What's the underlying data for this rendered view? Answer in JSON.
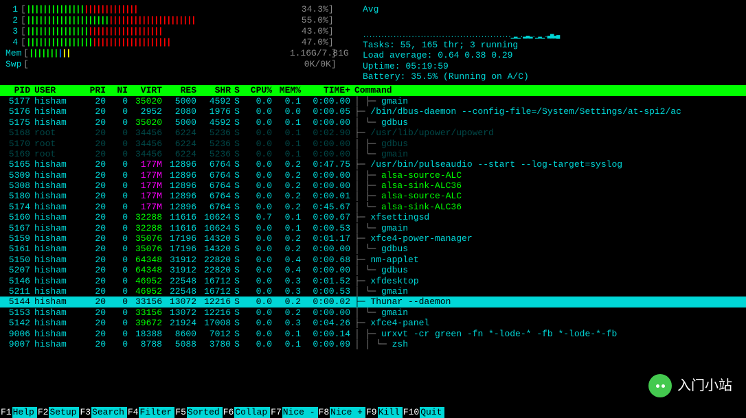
{
  "cpus": [
    {
      "n": "1",
      "bars": "ggggggggggggggrrrrrrrrrrrrr",
      "pct": "34.3%"
    },
    {
      "n": "2",
      "bars": "ggggggggggggggggggggrrrrrrrrrrrrrrrrrrrrr",
      "pct": "55.0%"
    },
    {
      "n": "3",
      "bars": "gggggggggggggggrrrrrrrrrrrrrrrrrr",
      "pct": "43.0%"
    },
    {
      "n": "4",
      "bars": "ggggggggggggggggrrrrrrrrrrrrrrrrrrr",
      "pct": "47.0%"
    }
  ],
  "mem": {
    "label": "Mem",
    "bars": "gggggggbyy",
    "val": "1.16G/7.81G"
  },
  "swp": {
    "label": "Swp",
    "val": "0K/0K"
  },
  "avg_label": "Avg",
  "tasks": "Tasks: 55, 165 thr; 3 running",
  "load": "Load average: 0.64 0.38 0.29",
  "uptime": "Uptime: 05:19:59",
  "battery": "Battery: 35.5% (Running on A/C)",
  "columns": {
    "pid": "PID",
    "user": "USER",
    "pri": "PRI",
    "ni": "NI",
    "virt": "VIRT",
    "res": "RES",
    "shr": "SHR",
    "s": "S",
    "cpu": "CPU%",
    "mem": "MEM%",
    "time": "TIME+",
    "cmd": "Command"
  },
  "rows": [
    {
      "pid": "5177",
      "user": "hisham",
      "pri": "20",
      "ni": "0",
      "virt": "35020",
      "res": "5000",
      "shr": "4592",
      "s": "S",
      "cpu": "0.0",
      "mem": "0.1",
      "time": "0:00.00",
      "tree": "   │  ├─ ",
      "cmd": "gmain",
      "virt_hl": true
    },
    {
      "pid": "5176",
      "user": "hisham",
      "pri": "20",
      "ni": "0",
      "virt": "2952",
      "res": "2080",
      "shr": "1976",
      "s": "S",
      "cpu": "0.0",
      "mem": "0.0",
      "time": "0:00.05",
      "tree": "   ├─ ",
      "cmd": "/bin/dbus-daemon --config-file=/System/Settings/at-spi2/ac"
    },
    {
      "pid": "5175",
      "user": "hisham",
      "pri": "20",
      "ni": "0",
      "virt": "35020",
      "res": "5000",
      "shr": "4592",
      "s": "S",
      "cpu": "0.0",
      "mem": "0.1",
      "time": "0:00.00",
      "tree": "   │  └─ ",
      "cmd": "gdbus",
      "virt_hl": true
    },
    {
      "pid": "5168",
      "user": "root",
      "pri": "20",
      "ni": "0",
      "virt": "34456",
      "res": "6224",
      "shr": "5236",
      "s": "S",
      "cpu": "0.0",
      "mem": "0.1",
      "time": "0:02.90",
      "tree": "   ├─ ",
      "cmd": "/usr/lib/upower/upowerd",
      "dim": true
    },
    {
      "pid": "5170",
      "user": "root",
      "pri": "20",
      "ni": "0",
      "virt": "34456",
      "res": "6224",
      "shr": "5236",
      "s": "S",
      "cpu": "0.0",
      "mem": "0.1",
      "time": "0:00.00",
      "tree": "   │  ├─ ",
      "cmd": "gdbus",
      "dim": true
    },
    {
      "pid": "5169",
      "user": "root",
      "pri": "20",
      "ni": "0",
      "virt": "34456",
      "res": "6224",
      "shr": "5236",
      "s": "S",
      "cpu": "0.0",
      "mem": "0.1",
      "time": "0:00.00",
      "tree": "   │  └─ ",
      "cmd": "gmain",
      "dim": true
    },
    {
      "pid": "5165",
      "user": "hisham",
      "pri": "20",
      "ni": "0",
      "virt": "177M",
      "res": "12896",
      "shr": "6764",
      "s": "S",
      "cpu": "0.0",
      "mem": "0.2",
      "time": "0:47.75",
      "tree": "   ├─ ",
      "cmd": "/usr/bin/pulseaudio --start --log-target=syslog",
      "virt_m": true
    },
    {
      "pid": "5309",
      "user": "hisham",
      "pri": "20",
      "ni": "0",
      "virt": "177M",
      "res": "12896",
      "shr": "6764",
      "s": "S",
      "cpu": "0.0",
      "mem": "0.2",
      "time": "0:00.00",
      "tree": "   │  ├─ ",
      "cmd": "alsa-source-ALC",
      "virt_m": true,
      "cmd_g": true
    },
    {
      "pid": "5308",
      "user": "hisham",
      "pri": "20",
      "ni": "0",
      "virt": "177M",
      "res": "12896",
      "shr": "6764",
      "s": "S",
      "cpu": "0.0",
      "mem": "0.2",
      "time": "0:00.00",
      "tree": "   │  ├─ ",
      "cmd": "alsa-sink-ALC36",
      "virt_m": true,
      "cmd_g": true
    },
    {
      "pid": "5180",
      "user": "hisham",
      "pri": "20",
      "ni": "0",
      "virt": "177M",
      "res": "12896",
      "shr": "6764",
      "s": "S",
      "cpu": "0.0",
      "mem": "0.2",
      "time": "0:00.01",
      "tree": "   │  ├─ ",
      "cmd": "alsa-source-ALC",
      "virt_m": true,
      "cmd_g": true
    },
    {
      "pid": "5174",
      "user": "hisham",
      "pri": "20",
      "ni": "0",
      "virt": "177M",
      "res": "12896",
      "shr": "6764",
      "s": "S",
      "cpu": "0.0",
      "mem": "0.2",
      "time": "0:45.67",
      "tree": "   │  └─ ",
      "cmd": "alsa-sink-ALC36",
      "virt_m": true,
      "cmd_g": true
    },
    {
      "pid": "5160",
      "user": "hisham",
      "pri": "20",
      "ni": "0",
      "virt": "32288",
      "res": "11616",
      "shr": "10624",
      "s": "S",
      "cpu": "0.7",
      "mem": "0.1",
      "time": "0:00.67",
      "tree": "   ├─ ",
      "cmd": "xfsettingsd",
      "virt_hl": true
    },
    {
      "pid": "5167",
      "user": "hisham",
      "pri": "20",
      "ni": "0",
      "virt": "32288",
      "res": "11616",
      "shr": "10624",
      "s": "S",
      "cpu": "0.0",
      "mem": "0.1",
      "time": "0:00.53",
      "tree": "   │  └─ ",
      "cmd": "gmain",
      "virt_hl": true
    },
    {
      "pid": "5159",
      "user": "hisham",
      "pri": "20",
      "ni": "0",
      "virt": "35076",
      "res": "17196",
      "shr": "14320",
      "s": "S",
      "cpu": "0.0",
      "mem": "0.2",
      "time": "0:01.17",
      "tree": "   ├─ ",
      "cmd": "xfce4-power-manager",
      "virt_hl": true
    },
    {
      "pid": "5161",
      "user": "hisham",
      "pri": "20",
      "ni": "0",
      "virt": "35076",
      "res": "17196",
      "shr": "14320",
      "s": "S",
      "cpu": "0.0",
      "mem": "0.2",
      "time": "0:00.00",
      "tree": "   │  └─ ",
      "cmd": "gdbus",
      "virt_hl": true
    },
    {
      "pid": "5150",
      "user": "hisham",
      "pri": "20",
      "ni": "0",
      "virt": "64348",
      "res": "31912",
      "shr": "22820",
      "s": "S",
      "cpu": "0.0",
      "mem": "0.4",
      "time": "0:00.68",
      "tree": "   ├─ ",
      "cmd": "nm-applet",
      "virt_hl": true
    },
    {
      "pid": "5207",
      "user": "hisham",
      "pri": "20",
      "ni": "0",
      "virt": "64348",
      "res": "31912",
      "shr": "22820",
      "s": "S",
      "cpu": "0.0",
      "mem": "0.4",
      "time": "0:00.00",
      "tree": "   │  └─ ",
      "cmd": "gdbus",
      "virt_hl": true
    },
    {
      "pid": "5146",
      "user": "hisham",
      "pri": "20",
      "ni": "0",
      "virt": "46952",
      "res": "22548",
      "shr": "16712",
      "s": "S",
      "cpu": "0.0",
      "mem": "0.3",
      "time": "0:01.52",
      "tree": "   ├─ ",
      "cmd": "xfdesktop",
      "virt_hl": true
    },
    {
      "pid": "5211",
      "user": "hisham",
      "pri": "20",
      "ni": "0",
      "virt": "46952",
      "res": "22548",
      "shr": "16712",
      "s": "S",
      "cpu": "0.0",
      "mem": "0.3",
      "time": "0:00.53",
      "tree": "   │  └─ ",
      "cmd": "gmain",
      "virt_hl": true
    },
    {
      "pid": "5144",
      "user": "hisham",
      "pri": "20",
      "ni": "0",
      "virt": "33156",
      "res": "13072",
      "shr": "12216",
      "s": "S",
      "cpu": "0.0",
      "mem": "0.2",
      "time": "0:00.02",
      "tree": "   ├─ ",
      "cmd": "Thunar --daemon",
      "sel": true
    },
    {
      "pid": "5153",
      "user": "hisham",
      "pri": "20",
      "ni": "0",
      "virt": "33156",
      "res": "13072",
      "shr": "12216",
      "s": "S",
      "cpu": "0.0",
      "mem": "0.2",
      "time": "0:00.00",
      "tree": "   │  └─ ",
      "cmd": "gmain",
      "virt_hl": true
    },
    {
      "pid": "5142",
      "user": "hisham",
      "pri": "20",
      "ni": "0",
      "virt": "39672",
      "res": "21924",
      "shr": "17008",
      "s": "S",
      "cpu": "0.0",
      "mem": "0.3",
      "time": "0:04.26",
      "tree": "   ├─ ",
      "cmd": "xfce4-panel",
      "virt_hl": true
    },
    {
      "pid": "9006",
      "user": "hisham",
      "pri": "20",
      "ni": "0",
      "virt": "18388",
      "res": "8600",
      "shr": "7012",
      "s": "S",
      "cpu": "0.0",
      "mem": "0.1",
      "time": "0:00.14",
      "tree": "   │  ├─ ",
      "cmd": "urxvt -cr green -fn *-lode-* -fb *-lode-*-fb"
    },
    {
      "pid": "9007",
      "user": "hisham",
      "pri": "20",
      "ni": "0",
      "virt": "8788",
      "res": "5088",
      "shr": "3780",
      "s": "S",
      "cpu": "0.0",
      "mem": "0.1",
      "time": "0:00.09",
      "tree": "   │  │  └─ ",
      "cmd": "zsh"
    }
  ],
  "fkeys": [
    {
      "k": "F1",
      "l": "Help"
    },
    {
      "k": "F2",
      "l": "Setup"
    },
    {
      "k": "F3",
      "l": "Search"
    },
    {
      "k": "F4",
      "l": "Filter"
    },
    {
      "k": "F5",
      "l": "Sorted"
    },
    {
      "k": "F6",
      "l": "Collap"
    },
    {
      "k": "F7",
      "l": "Nice -"
    },
    {
      "k": "F8",
      "l": "Nice +"
    },
    {
      "k": "F9",
      "l": "Kill"
    },
    {
      "k": "F10",
      "l": "Quit"
    }
  ],
  "watermark": "入门小站"
}
